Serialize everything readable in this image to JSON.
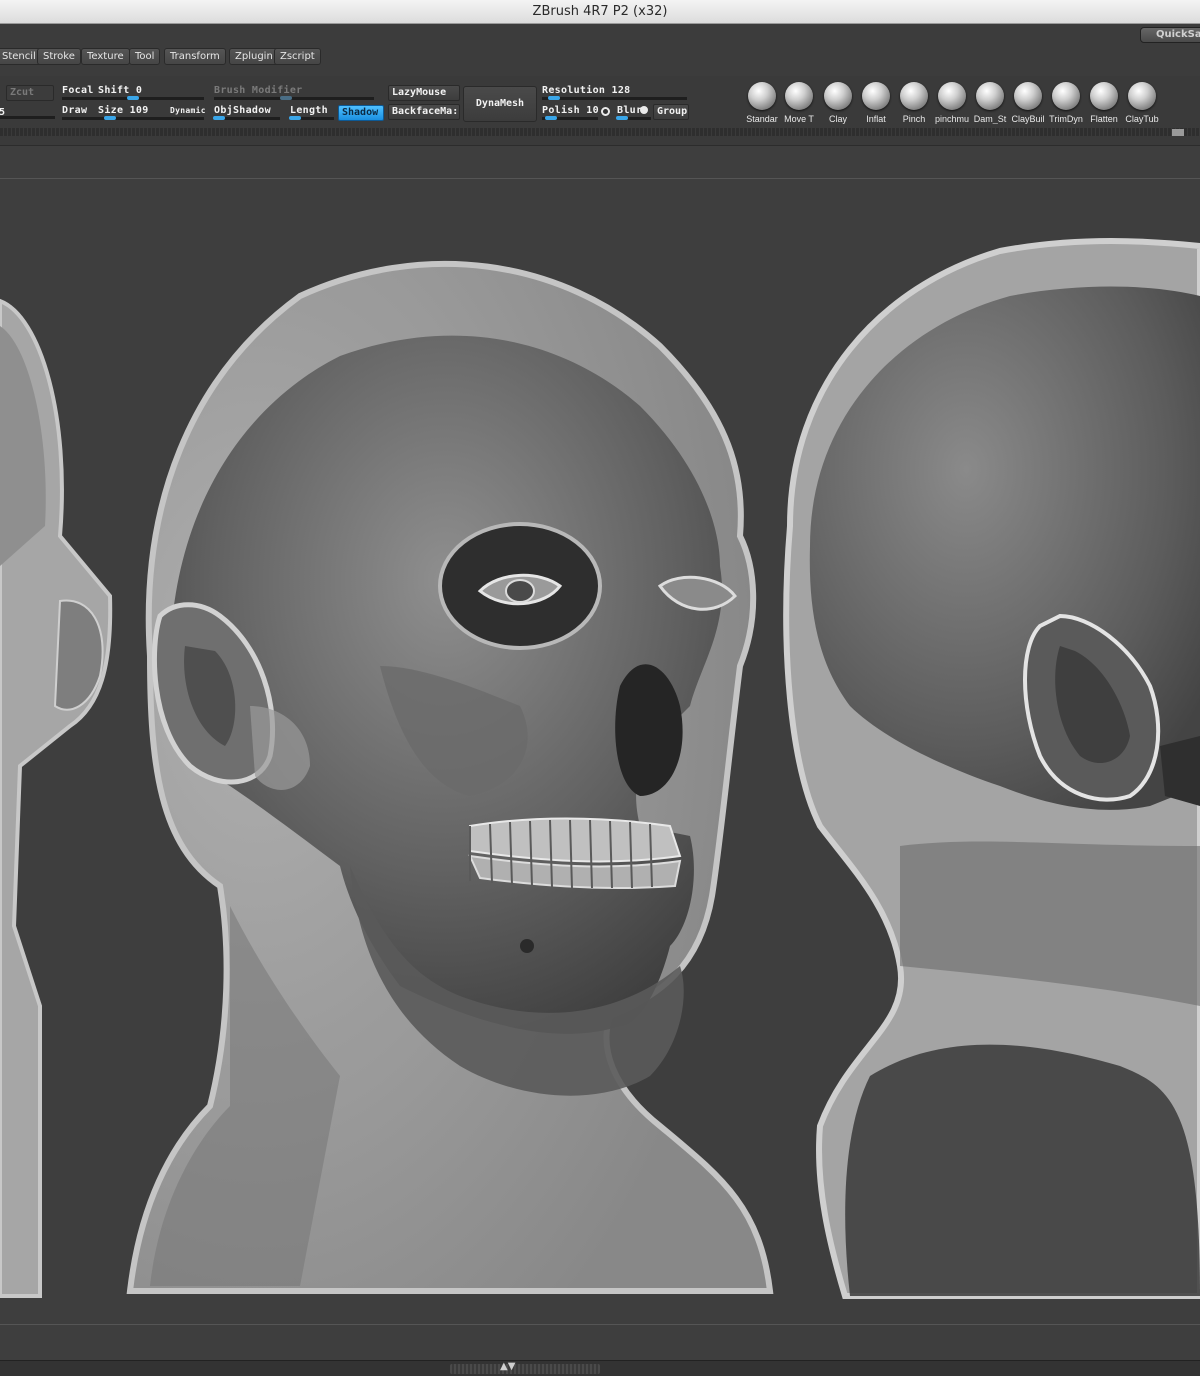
{
  "window": {
    "title": "ZBrush 4R7 P2 (x32)"
  },
  "menu": {
    "items": [
      "Stencil",
      "Stroke",
      "Texture",
      "Tool",
      "Transform",
      "Zplugin",
      "Zscript"
    ],
    "quicksave": "QuickSa"
  },
  "shelf": {
    "left_number": "5",
    "zcut": "Zcut",
    "focal_label": "Focal",
    "shift_label": "Shift 0",
    "draw_label": "Draw",
    "size_label": "Size 109",
    "dynamic": "Dynamic",
    "brush_modifier": "Brush Modifier",
    "objshadow": "ObjShadow",
    "length": "Length",
    "shadow": "Shadow",
    "lazymouse": "LazyMouse",
    "backfacemask": "BackfaceMa:",
    "dynamesh": "DynaMesh",
    "resolution": "Resolution 128",
    "polish": "Polish 10",
    "blur": "Blur",
    "group": "Group",
    "brushes": [
      "Standar",
      "Move T",
      "Clay",
      "Inflat",
      "Pinch",
      "pinchmu",
      "Dam_St",
      "ClayBuil",
      "TrimDyn",
      "Flatten",
      "ClayTub"
    ]
  },
  "colors": {
    "accent": "#3aa6e8",
    "canvas_bg": "#3e3e3e",
    "ui_bg": "#3a3a3a"
  },
  "canvas": {
    "content": "Three sculpted head views: left partial side view, center three-quarter view with transparent skin over skull, right rear three-quarter view"
  }
}
